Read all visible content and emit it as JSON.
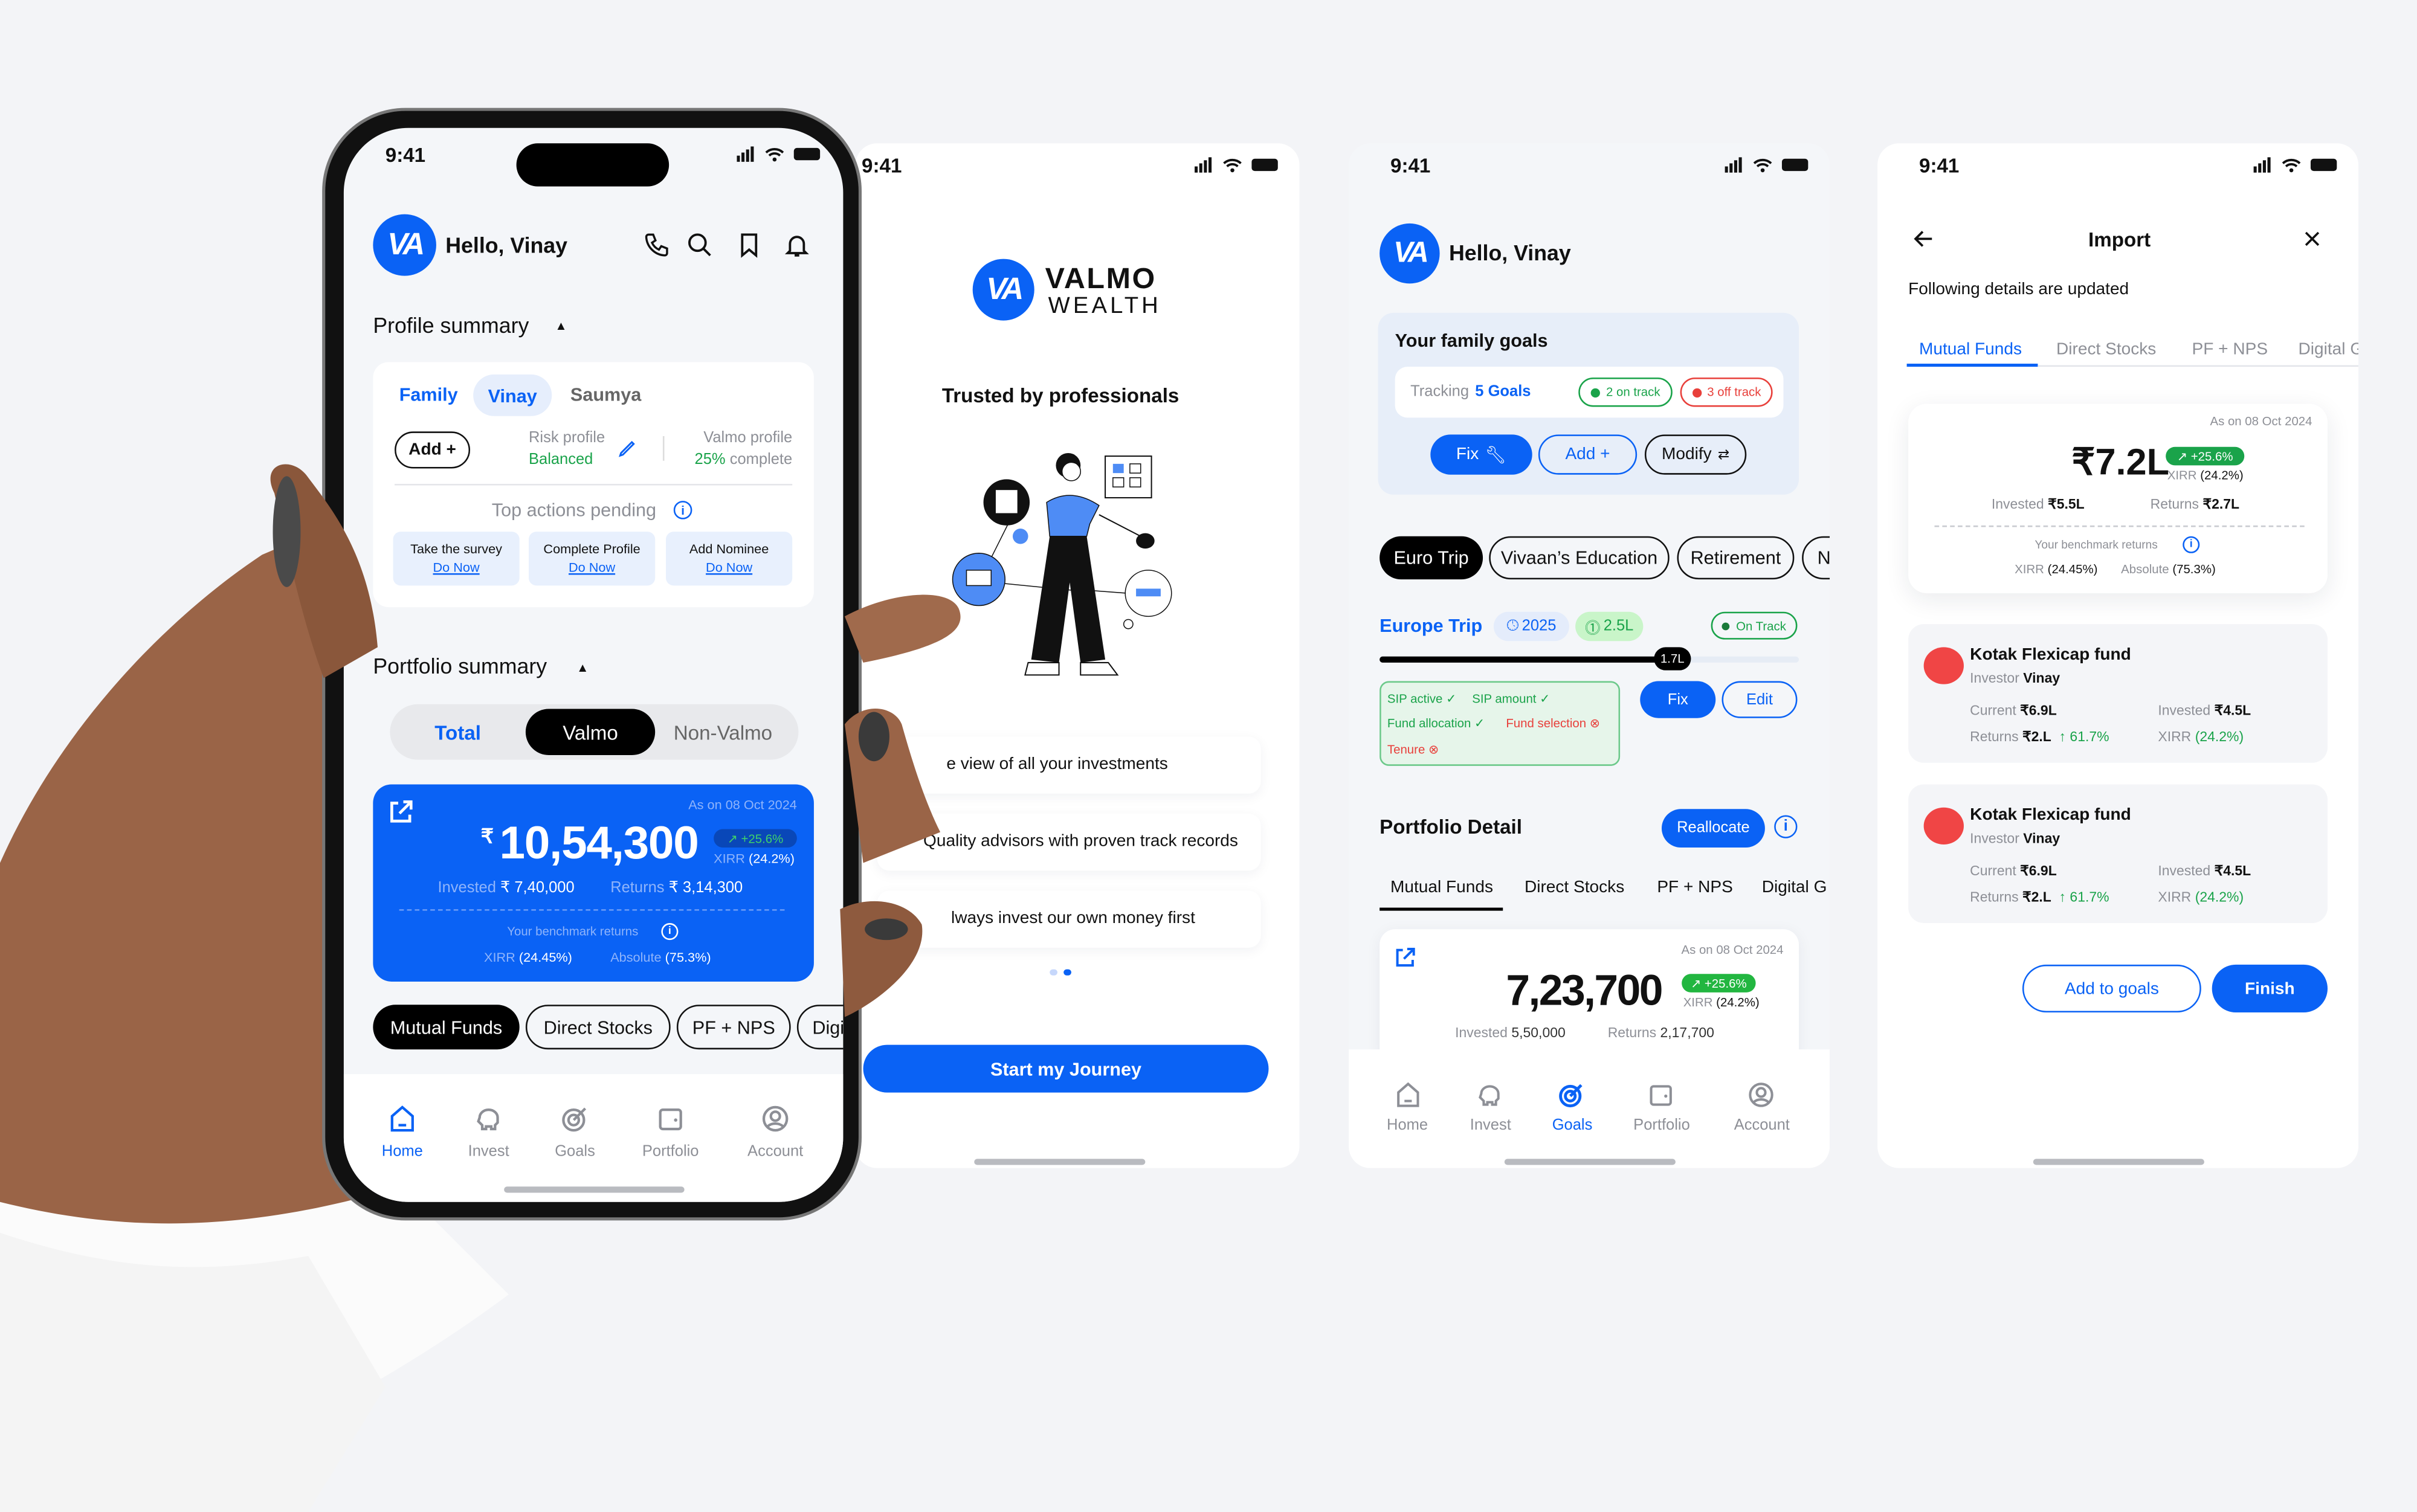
{
  "colors": {
    "brand": "#0a62f5",
    "positive": "#1aa34a",
    "negative": "#e8403b",
    "background": "#f3f4f7"
  },
  "status_time": "9:41",
  "logo_text": "VA",
  "screen_home": {
    "greeting": "Hello, Vinay",
    "header_icons": [
      "phone-icon",
      "search-icon",
      "bookmark-icon",
      "bell-icon"
    ],
    "profile_summary": "Profile summary",
    "profile_tabs": [
      "Family",
      "Vinay",
      "Saumya"
    ],
    "add_label": "Add +",
    "risk_profile_label": "Risk profile",
    "risk_profile_value": "Balanced",
    "valmo_profile_label": "Valmo profile",
    "valmo_profile_pct": "25%",
    "valmo_profile_suffix": "complete",
    "top_actions": "Top actions pending",
    "actions": [
      {
        "title": "Take the survey",
        "link": "Do Now"
      },
      {
        "title": "Complete Profile",
        "link": "Do Now"
      },
      {
        "title": "Add Nominee",
        "link": "Do Now"
      }
    ],
    "portfolio_summary": "Portfolio summary",
    "segments": [
      "Total",
      "Valmo",
      "Non-Valmo"
    ],
    "card": {
      "as_on": "As on 08 Oct 2024",
      "currency": "₹",
      "value": "10,54,300",
      "change": "↗ +25.6%",
      "xirr_label": "XIRR",
      "xirr": "(24.2%)",
      "invested_label": "Invested",
      "invested": "₹ 7,40,000",
      "returns_label": "Returns",
      "returns": "₹ 3,14,300",
      "benchmark": "Your benchmark returns",
      "bxirr_label": "XIRR",
      "bxirr": "(24.45%)",
      "abs_label": "Absolute",
      "abs": "(75.3%)"
    },
    "asset_pills": [
      "Mutual Funds",
      "Direct Stocks",
      "PF + NPS",
      "Digi"
    ],
    "nav": [
      "Home",
      "Invest",
      "Goals",
      "Portfolio",
      "Account"
    ]
  },
  "screen_onboarding": {
    "brand_top": "VALMO",
    "brand_bottom": "WEALTH",
    "headline": "Trusted by professionals",
    "points": [
      "e view of all your investments",
      "Quality advisors with proven track records",
      "lways invest our own money first"
    ],
    "page_index": 2,
    "page_count": 2,
    "cta": "Start my Journey"
  },
  "screen_goals": {
    "greeting": "Hello, Vinay",
    "family_goals": "Your family goals",
    "tracking_label": "Tracking",
    "tracking_value": "5 Goals",
    "on_track": "2 on track",
    "off_track": "3 off track",
    "fix": "Fix",
    "add": "Add +",
    "modify": "Modify",
    "goal_pills": [
      "Euro Trip",
      "Vivaan’s Education",
      "Retirement",
      "N"
    ],
    "goal_name": "Europe Trip",
    "goal_year": "2025",
    "goal_amount": "2.5L",
    "goal_status": "On Track",
    "progress_value": "1.7L",
    "progress_fraction": 0.68,
    "checks": [
      {
        "label": "SIP active",
        "ok": true
      },
      {
        "label": "SIP amount",
        "ok": true
      },
      {
        "label": "Fund allocation",
        "ok": true
      },
      {
        "label": "Fund selection",
        "ok": false
      },
      {
        "label": "Tenure",
        "ok": false
      }
    ],
    "fix_btn": "Fix",
    "edit_btn": "Edit",
    "portfolio_detail": "Portfolio Detail",
    "reallocate": "Reallocate",
    "tabs": [
      "Mutual Funds",
      "Direct Stocks",
      "PF + NPS",
      "Digital G"
    ],
    "card": {
      "as_on": "As on 08 Oct 2024",
      "value": "7,23,700",
      "change": "↗ +25.6%",
      "xirr_label": "XIRR",
      "xirr": "(24.2%)",
      "invested_label": "Invested",
      "invested": "5,50,000",
      "returns_label": "Returns",
      "returns": "2,17,700"
    },
    "nav": [
      "Home",
      "Invest",
      "Goals",
      "Portfolio",
      "Account"
    ]
  },
  "screen_import": {
    "title": "Import",
    "subtitle": "Following details are updated",
    "tabs": [
      "Mutual Funds",
      "Direct Stocks",
      "PF + NPS",
      "Digital G"
    ],
    "summary": {
      "as_on": "As on 08 Oct 2024",
      "value": "₹7.2L",
      "change": "↗ +25.6%",
      "xirr_label": "XIRR",
      "xirr": "(24.2%)",
      "invested_label": "Invested",
      "invested": "₹5.5L",
      "returns_label": "Returns",
      "returns": "₹2.7L",
      "benchmark": "Your benchmark returns",
      "bxirr_label": "XIRR",
      "bxirr": "(24.45%)",
      "abs_label": "Absolute",
      "abs": "(75.3%)"
    },
    "funds": [
      {
        "name": "Kotak Flexicap fund",
        "investor_label": "Investor",
        "investor": "Vinay",
        "current_label": "Current",
        "current": "₹6.9L",
        "invested_label": "Invested",
        "invested": "₹4.5L",
        "returns_label": "Returns",
        "returns": "₹2.L",
        "returns_pct": "↑ 61.7%",
        "xirr_label": "XIRR",
        "xirr": "(24.2%)"
      },
      {
        "name": "Kotak Flexicap fund",
        "investor_label": "Investor",
        "investor": "Vinay",
        "current_label": "Current",
        "current": "₹6.9L",
        "invested_label": "Invested",
        "invested": "₹4.5L",
        "returns_label": "Returns",
        "returns": "₹2.L",
        "returns_pct": "↑ 61.7%",
        "xirr_label": "XIRR",
        "xirr": "(24.2%)"
      }
    ],
    "add_to_goals": "Add to goals",
    "finish": "Finish"
  }
}
